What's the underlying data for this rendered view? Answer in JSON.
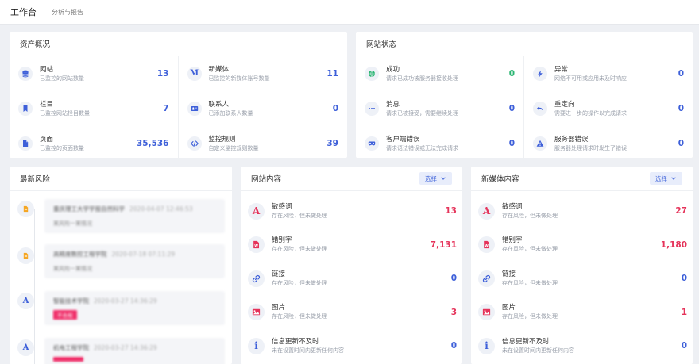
{
  "topbar": {
    "title": "工作台",
    "tab": "分析与报告"
  },
  "assets": {
    "title": "资产概况",
    "items": [
      {
        "name": "网站",
        "desc": "已监控的网站数量",
        "value": "13",
        "icon": "database-icon"
      },
      {
        "name": "新媒体",
        "desc": "已监控的新媒体账号数量",
        "value": "11",
        "icon": "media-m-icon"
      },
      {
        "name": "栏目",
        "desc": "已监控网站栏目数量",
        "value": "7",
        "icon": "bookmark-icon"
      },
      {
        "name": "联系人",
        "desc": "已添加联系人数量",
        "value": "0",
        "icon": "contact-card-icon"
      },
      {
        "name": "页面",
        "desc": "已监控的页面数量",
        "value": "35,536",
        "icon": "file-icon"
      },
      {
        "name": "监控规则",
        "desc": "自定义监控规则数量",
        "value": "39",
        "icon": "code-icon"
      }
    ]
  },
  "status": {
    "title": "网站状态",
    "items": [
      {
        "name": "成功",
        "desc": "请求已成功被服务器接收处理",
        "value": "0",
        "icon": "globe-icon",
        "tone": "green"
      },
      {
        "name": "异常",
        "desc": "网络不可用或应用未及时响应",
        "value": "0",
        "icon": "bolt-icon",
        "tone": "blue"
      },
      {
        "name": "消息",
        "desc": "请求已被接受，需要继续处理",
        "value": "0",
        "icon": "ellipsis-icon",
        "tone": "blue"
      },
      {
        "name": "重定向",
        "desc": "需要进一步的操作以完成请求",
        "value": "0",
        "icon": "reply-icon",
        "tone": "blue"
      },
      {
        "name": "客户端错误",
        "desc": "请求语法错误或无法完成请求",
        "value": "0",
        "icon": "mask-icon",
        "tone": "blue"
      },
      {
        "name": "服务器错误",
        "desc": "服务器处理请求时发生了错误",
        "value": "0",
        "icon": "warning-icon",
        "tone": "blue"
      }
    ]
  },
  "risks": {
    "title": "最新风险",
    "items": [
      {
        "icon": "document-icon",
        "title": "重庆理工大学学报自然科学",
        "time": "2020-04-07 12:46:53",
        "sub": "某风险一某情况",
        "tag": ""
      },
      {
        "icon": "document-icon",
        "title": "高精度数控工程学院",
        "time": "2020-07-18 07:11:29",
        "sub": "某风险一某情况",
        "tag": ""
      },
      {
        "icon": "font-a-icon",
        "title": "智能技术学院",
        "time": "2020-03-27 14:36:29",
        "sub": "",
        "tag": "不合规"
      },
      {
        "icon": "font-a-icon",
        "title": "机电工程学院",
        "time": "2020-03-27 14:36:29",
        "sub": "",
        "tag": ""
      }
    ]
  },
  "site_content": {
    "title": "网站内容",
    "select_label": "选择",
    "items": [
      {
        "name": "敏感词",
        "desc": "存在风险，但未做处理",
        "value": "13",
        "icon": "font-a-icon",
        "tone": "red"
      },
      {
        "name": "错别字",
        "desc": "存在风险，但未做处理",
        "value": "7,131",
        "icon": "word-file-icon",
        "tone": "red"
      },
      {
        "name": "链接",
        "desc": "存在风险，但未做处理",
        "value": "0",
        "icon": "link-icon",
        "tone": "blue"
      },
      {
        "name": "图片",
        "desc": "存在风险，但未做处理",
        "value": "3",
        "icon": "image-icon",
        "tone": "red"
      },
      {
        "name": "信息更新不及时",
        "desc": "未在设置时间内更新任何内容",
        "value": "0",
        "icon": "info-icon",
        "tone": "blue"
      }
    ]
  },
  "media_content": {
    "title": "新媒体内容",
    "select_label": "选择",
    "items": [
      {
        "name": "敏感词",
        "desc": "存在风险，但未做处理",
        "value": "27",
        "icon": "font-a-icon",
        "tone": "red"
      },
      {
        "name": "错别字",
        "desc": "存在风险，但未做处理",
        "value": "1,180",
        "icon": "word-file-icon",
        "tone": "red"
      },
      {
        "name": "链接",
        "desc": "存在风险，但未做处理",
        "value": "0",
        "icon": "link-icon",
        "tone": "blue"
      },
      {
        "name": "图片",
        "desc": "存在风险，但未做处理",
        "value": "1",
        "icon": "image-icon",
        "tone": "red"
      },
      {
        "name": "信息更新不及时",
        "desc": "未在设置时间内更新任何内容",
        "value": "0",
        "icon": "info-icon",
        "tone": "blue"
      }
    ]
  },
  "colors": {
    "primary": "#3d5fd9",
    "danger": "#e5335a",
    "success": "#2bb673",
    "page_bg": "#eef0f4"
  }
}
